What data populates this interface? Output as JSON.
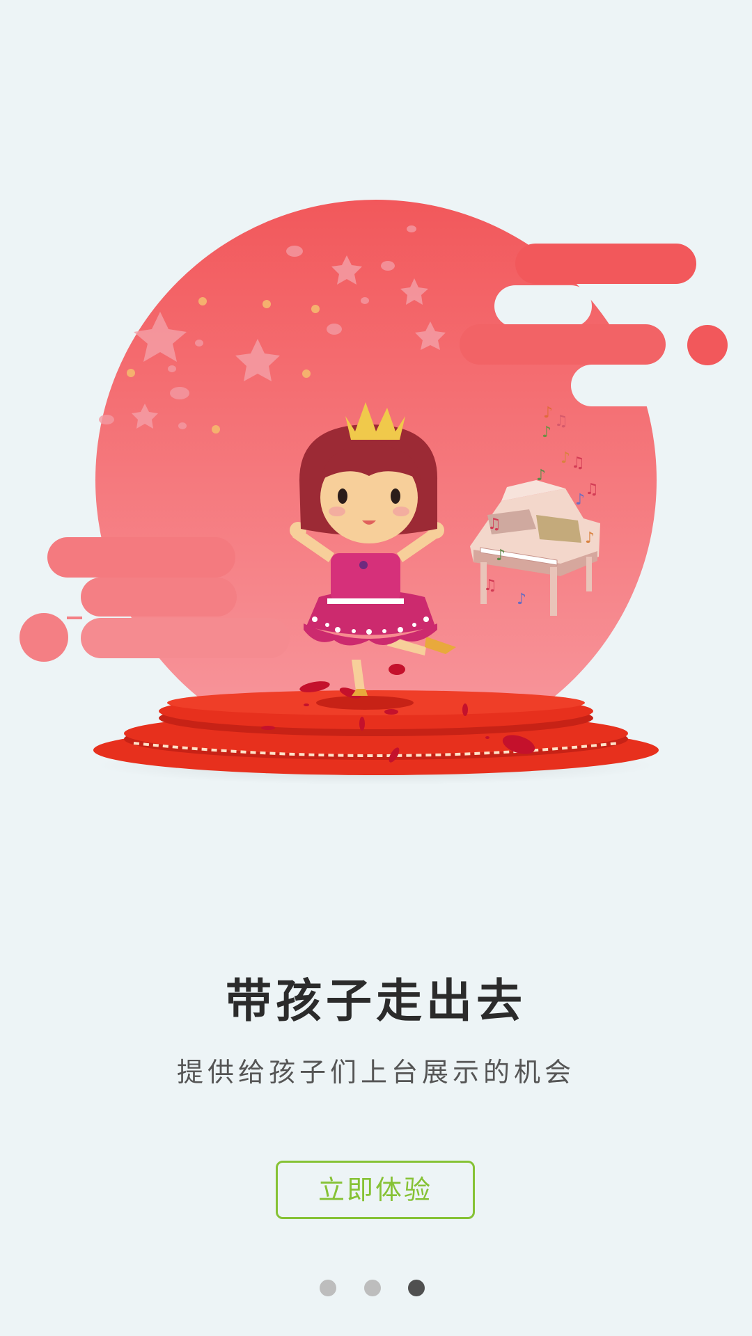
{
  "onboarding": {
    "page_title": "带孩子走出去",
    "page_subtitle": "提供给孩子们上台展示的机会",
    "cta_label": "立即体验",
    "active_page_index": 3,
    "page_count": 3
  },
  "colors": {
    "background": "#edf4f6",
    "circle_top": "#f2585b",
    "circle_bottom": "#f89aa0",
    "stage_red": "#e7301d",
    "accent_green": "#86c235",
    "dot_inactive": "#bdbdbd",
    "dot_active": "#505050"
  }
}
